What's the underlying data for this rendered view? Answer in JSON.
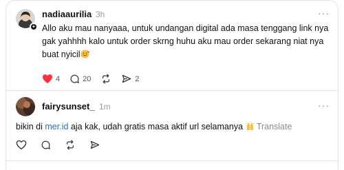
{
  "posts": [
    {
      "username": "nadiaaurilia",
      "time": "3h",
      "text": "Allo aku mau nanyaaa, untuk undangan digital ada masa tenggang link nya gak yahhhh kalo untuk order skrng huhu aku mau order sekarang niat nya buat nyicil",
      "emoji": "smiling-face-with-hearts",
      "liked": true,
      "likes": "4",
      "replies": "20",
      "reposts": "",
      "shares": "2"
    },
    {
      "username": "fairysunset_",
      "time": "1m",
      "text_before_link": "bikin di ",
      "link": "mer.id",
      "text_after_link": " aja kak, udah gratis masa aktif url selamanya",
      "emoji": "raising-hands",
      "translate": "Translate",
      "liked": false
    }
  ],
  "more_label": "···",
  "colors": {
    "like_red": "#ff3040",
    "link_blue": "#2f6fb5"
  }
}
